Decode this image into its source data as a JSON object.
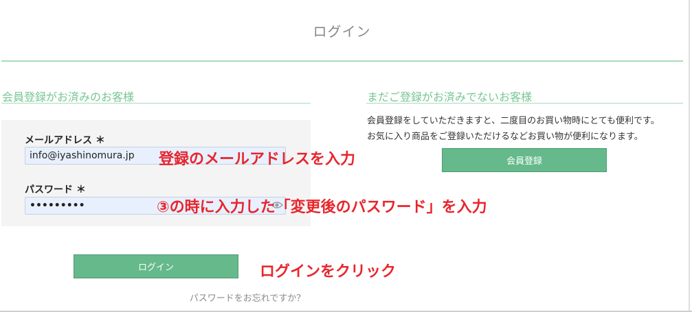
{
  "page": {
    "title": "ログイン"
  },
  "member_section": {
    "heading": "会員登録がお済みのお客様",
    "email_label": "メールアドレス ＊",
    "email_value": "info@iyashinomura.jp",
    "password_label": "パスワード ＊",
    "password_value": "•••••••••",
    "login_button": "ログイン",
    "forgot_link": "パスワードをお忘れですか？"
  },
  "guest_section": {
    "heading": "まだご登録がお済みでないお客様",
    "line1": "会員登録をしていただきますと、二度目のお買い物時にとても便利です。",
    "line2": "お気に入り商品をご登録いただけるなどお買い物が便利になります。",
    "register_button": "会員登録"
  },
  "annotations": {
    "email_note": "登録のメールアドレスを入力",
    "password_note": "③の時に入力した「変更後のパスワード」を入力",
    "login_note": "ログインをクリック"
  },
  "colors": {
    "accent_green": "#65b98a",
    "heading_green": "#77c593",
    "annotation_red": "#e8242b"
  },
  "icons": {
    "password_toggle": "eye-icon"
  }
}
